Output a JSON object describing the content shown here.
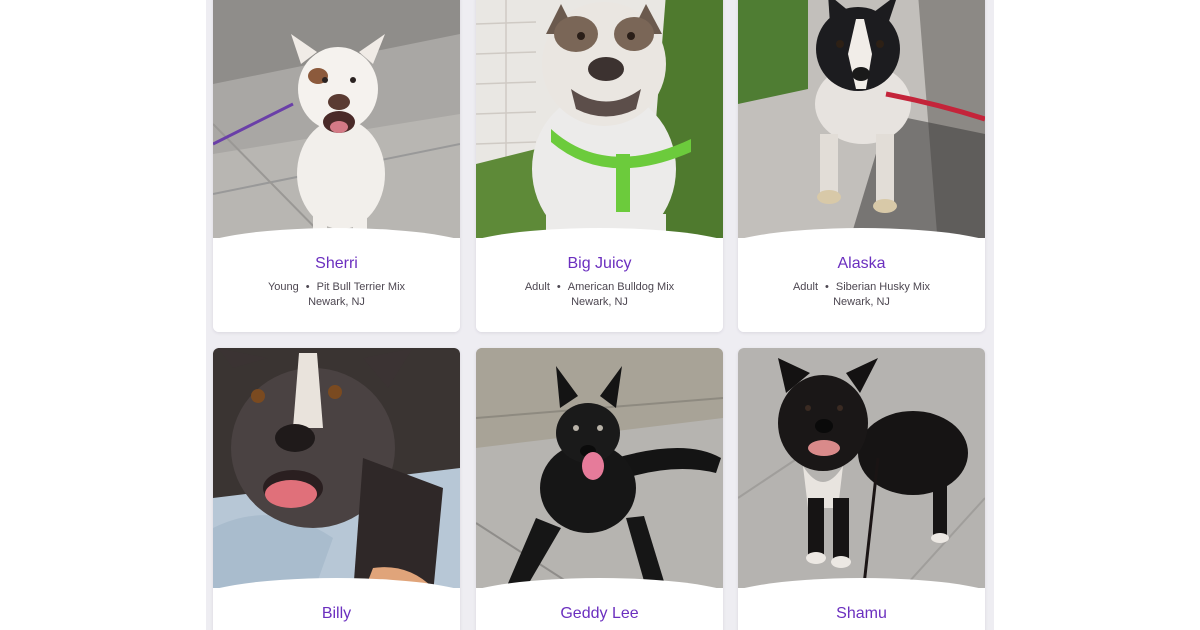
{
  "pets": [
    {
      "name": "Sherri",
      "age": "Young",
      "breed": "Pit Bull Terrier Mix",
      "location": "Newark, NJ"
    },
    {
      "name": "Big Juicy",
      "age": "Adult",
      "breed": "American Bulldog Mix",
      "location": "Newark, NJ"
    },
    {
      "name": "Alaska",
      "age": "Adult",
      "breed": "Siberian Husky Mix",
      "location": "Newark, NJ"
    },
    {
      "name": "Billy"
    },
    {
      "name": "Geddy Lee"
    },
    {
      "name": "Shamu"
    }
  ],
  "separator": "•",
  "colors": {
    "name_link": "#6b2fbf",
    "meta_text": "#4d4751",
    "grid_background": "#eeedf2"
  }
}
